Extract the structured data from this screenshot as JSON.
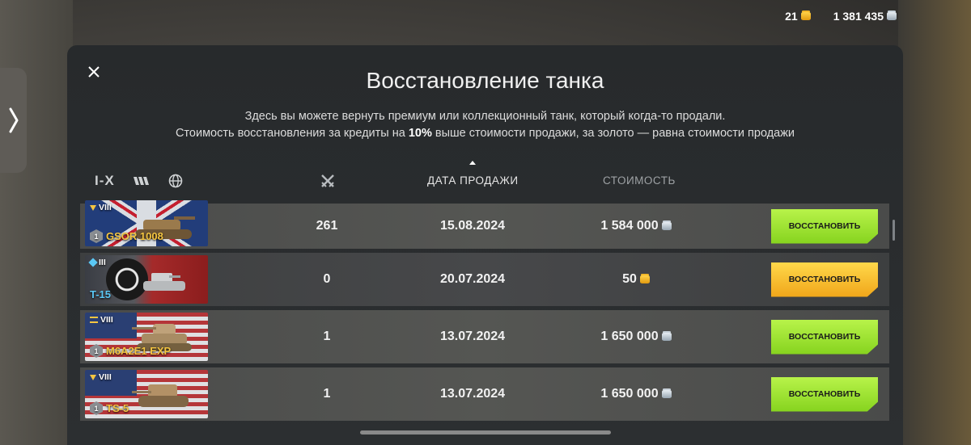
{
  "currencies": {
    "gold": "21",
    "credits": "1 381 435"
  },
  "modal": {
    "title": "Восстановление танка",
    "desc_line1": "Здесь вы можете вернуть премиум или коллекционный танк, который когда-то продали.",
    "desc_line2_a": "Стоимость восстановления за кредиты на ",
    "desc_line2_b": "10%",
    "desc_line2_c": " выше стоимости продажи, за золото — равна стоимости продажи"
  },
  "filters": {
    "tier": "I-X"
  },
  "columns": {
    "date": "ДАТА ПРОДАЖИ",
    "cost": "СТОИМОСТЬ"
  },
  "rows": [
    {
      "tier": "VIII",
      "name": "GSOR 1008",
      "battles": "261",
      "date": "15.08.2024",
      "cost": "1 584 000",
      "button": "ВОССТАНОВИТЬ"
    },
    {
      "tier": "III",
      "name": "T-15",
      "battles": "0",
      "date": "20.07.2024",
      "cost": "50",
      "button": "ВОССТАНОВИТЬ"
    },
    {
      "tier": "VIII",
      "name": "M6A2E1 EXP",
      "battles": "1",
      "date": "13.07.2024",
      "cost": "1 650 000",
      "button": "ВОССТАНОВИТЬ"
    },
    {
      "tier": "VIII",
      "name": "TS-5",
      "battles": "1",
      "date": "13.07.2024",
      "cost": "1 650 000",
      "button": "ВОССТАНОВИТЬ"
    }
  ],
  "colors": {
    "green_button": "#9be22f",
    "gold_button": "#f7c22e",
    "premium_name": "#f4c542",
    "collector_name": "#5bc8f5"
  }
}
